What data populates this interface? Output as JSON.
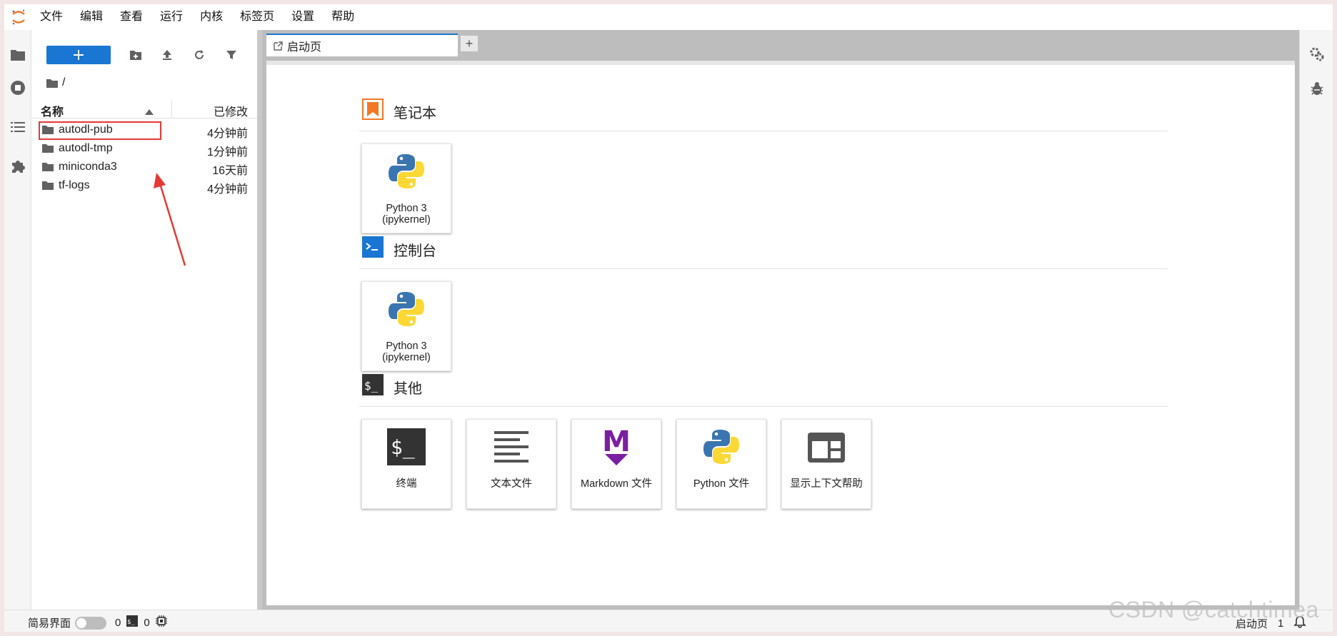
{
  "menu": [
    "文件",
    "编辑",
    "查看",
    "运行",
    "内核",
    "标签页",
    "设置",
    "帮助"
  ],
  "file_browser": {
    "path": "/",
    "columns": {
      "name": "名称",
      "modified": "已修改"
    },
    "items": [
      {
        "name": "autodl-pub",
        "modified": "4分钟前"
      },
      {
        "name": "autodl-tmp",
        "modified": "1分钟前"
      },
      {
        "name": "miniconda3",
        "modified": "16天前"
      },
      {
        "name": "tf-logs",
        "modified": "4分钟前"
      }
    ]
  },
  "tabs": [
    {
      "label": "启动页"
    }
  ],
  "launcher": {
    "sections": [
      {
        "title": "笔记本",
        "icon": "notebook-icon",
        "cards": [
          {
            "label": "Python 3 (ipykernel)",
            "icon": "python-icon"
          }
        ]
      },
      {
        "title": "控制台",
        "icon": "console-icon",
        "cards": [
          {
            "label": "Python 3 (ipykernel)",
            "icon": "python-icon"
          }
        ]
      },
      {
        "title": "其他",
        "icon": "other-icon",
        "cards": [
          {
            "label": "终端",
            "icon": "terminal-icon"
          },
          {
            "label": "文本文件",
            "icon": "text-file-icon"
          },
          {
            "label": "Markdown 文件",
            "icon": "markdown-icon"
          },
          {
            "label": "Python 文件",
            "icon": "python-icon"
          },
          {
            "label": "显示上下文帮助",
            "icon": "context-help-icon"
          }
        ]
      }
    ]
  },
  "statusbar": {
    "simple_mode_label": "简易界面",
    "kernels_count": "0",
    "terminals_count": "0",
    "current_tab": "启动页",
    "right_count": "1"
  },
  "watermark": "CSDN @catchtimea",
  "colors": {
    "accent": "#1976d2",
    "highlight": "#e53935",
    "notebook": "#f37726"
  }
}
